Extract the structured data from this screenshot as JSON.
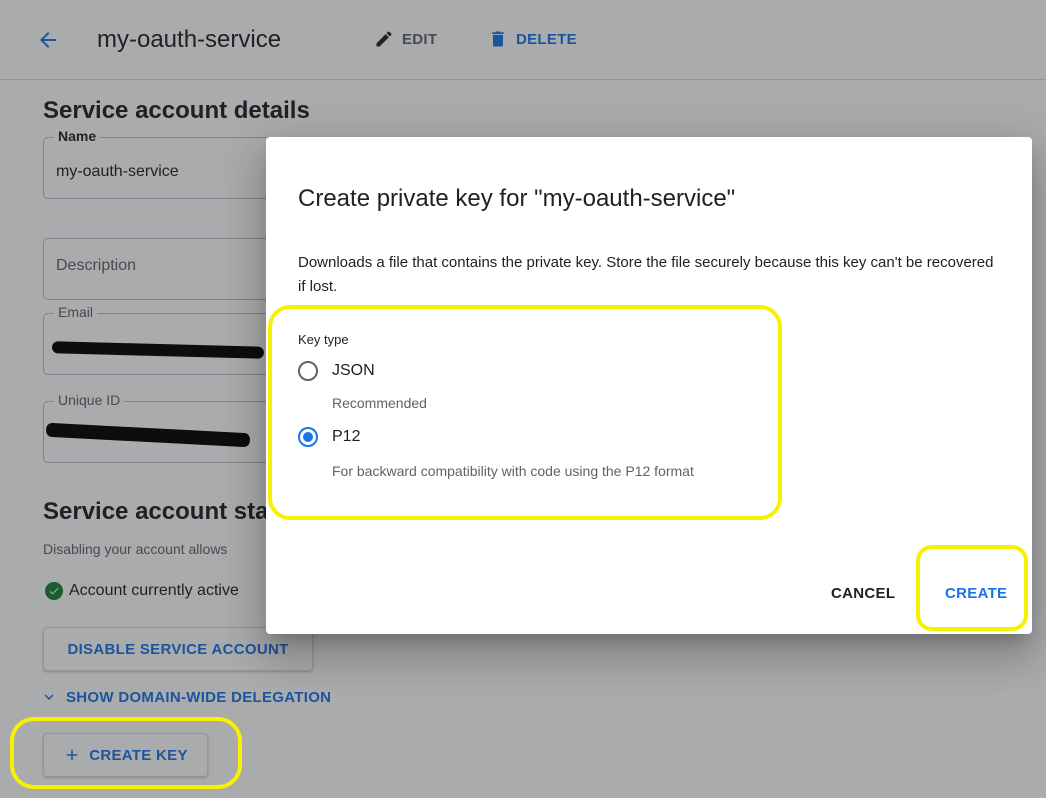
{
  "topbar": {
    "back_icon": "arrow-back-icon",
    "title": "my-oauth-service",
    "edit_label": "EDIT",
    "edit_icon": "pencil-icon",
    "delete_label": "DELETE",
    "delete_icon": "trash-icon"
  },
  "details": {
    "heading": "Service account details",
    "name_label": "Name",
    "name_value": "my-oauth-service",
    "description_placeholder": "Description",
    "email_label": "Email",
    "unique_id_label": "Unique ID"
  },
  "status": {
    "heading": "Service account sta",
    "description": "Disabling your account allows",
    "active_text": "Account currently active",
    "disable_button": "DISABLE SERVICE ACCOUNT",
    "show_delegation": "SHOW DOMAIN-WIDE DELEGATION",
    "create_key_button": "CREATE KEY"
  },
  "dialog": {
    "title": "Create private key for \"my-oauth-service\"",
    "description": "Downloads a file that contains the private key. Store the file securely because this key can't be recovered if lost.",
    "key_type_label": "Key type",
    "options": [
      {
        "label": "JSON",
        "hint": "Recommended",
        "selected": false
      },
      {
        "label": "P12",
        "hint": "For backward compatibility with code using the P12 format",
        "selected": true
      }
    ],
    "cancel_button": "CANCEL",
    "create_button": "CREATE"
  },
  "colors": {
    "accent": "#1a73e8",
    "success": "#188038",
    "annotation": "#f5f100"
  }
}
